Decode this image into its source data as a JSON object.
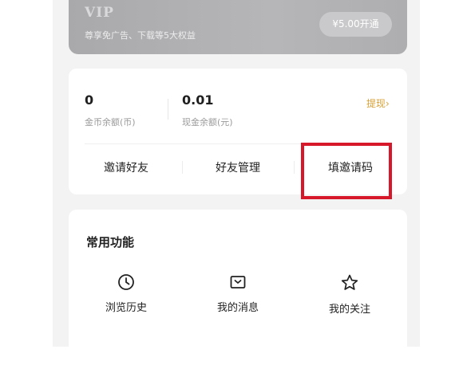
{
  "vip": {
    "title": "VIP",
    "subtitle": "尊享免广告、下载等5大权益",
    "button_label": "¥5.00开通"
  },
  "wallet": {
    "coin_balance": {
      "value": "0",
      "label": "金币余额(币)"
    },
    "cash_balance": {
      "value": "0.01",
      "label": "现金余额(元)"
    },
    "withdraw_label": "提现›",
    "actions": [
      {
        "label": "邀请好友"
      },
      {
        "label": "好友管理"
      },
      {
        "label": "填邀请码"
      }
    ]
  },
  "features": {
    "title": "常用功能",
    "items": [
      {
        "label": "浏览历史",
        "icon": "clock-icon"
      },
      {
        "label": "我的消息",
        "icon": "message-icon"
      },
      {
        "label": "我的关注",
        "icon": "star-icon"
      }
    ]
  },
  "colors": {
    "accent_gold": "#d8a037",
    "highlight_red": "#d6182a"
  }
}
